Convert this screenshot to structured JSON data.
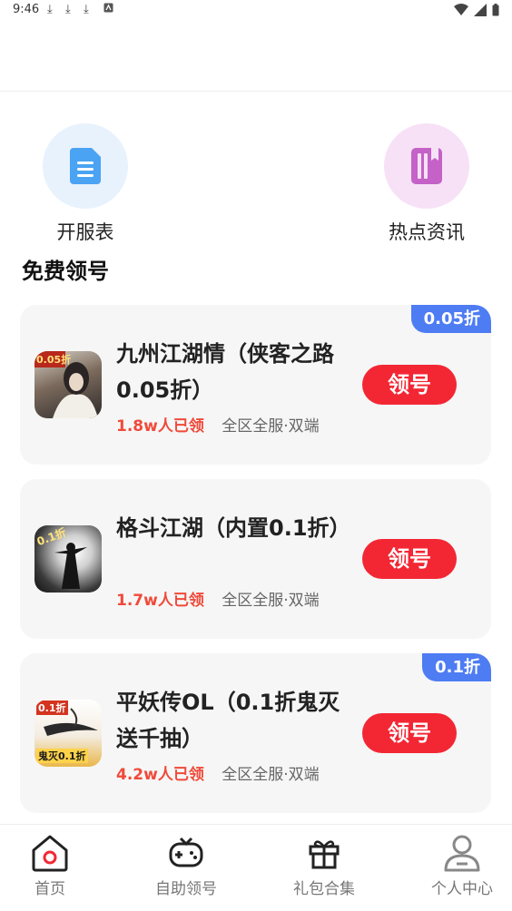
{
  "status_bar": {
    "time": "9:46",
    "download_glyph": "⤓"
  },
  "quick_links": [
    {
      "label": "开服表",
      "icon": "document-icon",
      "bg": "#e7f2fd",
      "color": "#4aa3f3"
    },
    {
      "label": "热点资讯",
      "icon": "book-icon",
      "bg": "#f7e1f6",
      "color": "#c462c7"
    }
  ],
  "section": {
    "title": "免费领号"
  },
  "games": [
    {
      "name": "九州江湖情（侠客之路0.05折）",
      "badge": "0.05折",
      "count": "1.8w人已领",
      "tag": "全区全服·双端",
      "button": "领号",
      "icon_label": "0.05折"
    },
    {
      "name": "格斗江湖（内置0.1折）",
      "badge": "",
      "count": "1.7w人已领",
      "tag": "全区全服·双端",
      "button": "领号",
      "icon_label": "0.1折"
    },
    {
      "name": "平妖传OL（0.1折鬼灭送千抽）",
      "badge": "0.1折",
      "count": "4.2w人已领",
      "tag": "全区全服·双端",
      "button": "领号",
      "icon_label": "0.1折",
      "icon_caption": "鬼灭0.1折"
    }
  ],
  "tabbar": [
    {
      "label": "首页",
      "icon": "home-icon",
      "active": true
    },
    {
      "label": "自助领号",
      "icon": "gamepad-icon"
    },
    {
      "label": "礼包合集",
      "icon": "gift-icon"
    },
    {
      "label": "个人中心",
      "icon": "user-icon"
    }
  ],
  "colors": {
    "accent": "#f32734",
    "badge": "#4d7cf3",
    "count": "#f04a3a"
  }
}
